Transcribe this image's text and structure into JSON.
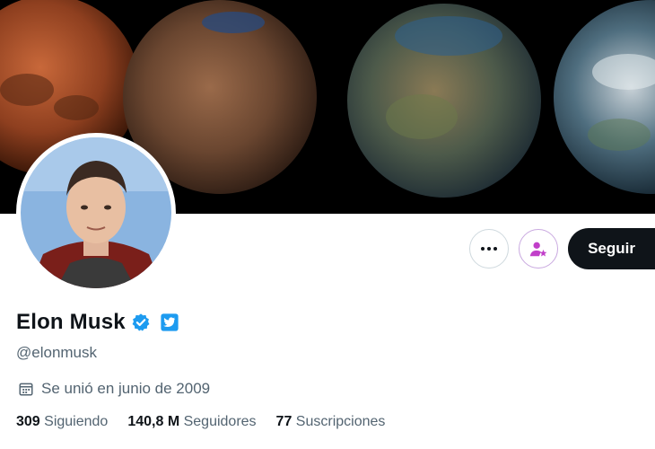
{
  "profile": {
    "name": "Elon Musk",
    "handle": "@elonmusk",
    "joined": "Se unió en junio de 2009"
  },
  "actions": {
    "follow_label": "Seguir"
  },
  "stats": [
    {
      "value": "309",
      "label": "Siguiendo"
    },
    {
      "value": "140,8 M",
      "label": "Seguidores"
    },
    {
      "value": "77",
      "label": "Suscripciones"
    }
  ],
  "colors": {
    "verified_blue": "#1d9bf0",
    "affiliate_blue": "#1d9bf0",
    "follow_bg": "#0f1419",
    "subscribe_accent": "#c13fc9"
  },
  "icons": {
    "more": "more-dots-icon",
    "subscribe": "subscribe-person-star-icon",
    "verified": "verified-badge-icon",
    "affiliate": "affiliate-badge-icon",
    "calendar": "calendar-icon"
  }
}
